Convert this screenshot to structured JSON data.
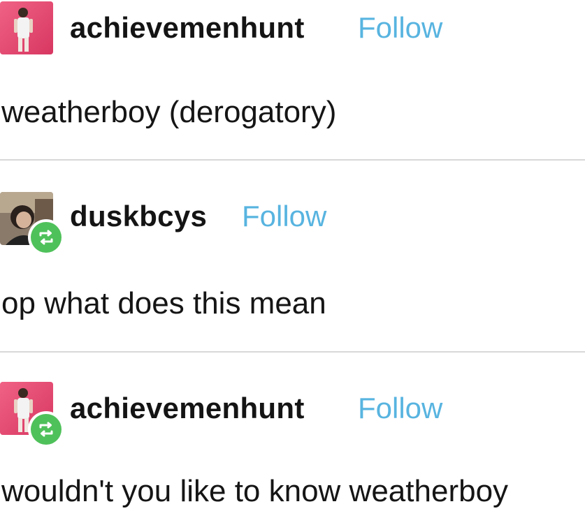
{
  "posts": [
    {
      "avatar_icon": "person-photo-avatar-pink",
      "username": "achievemenhunt",
      "follow_label": "Follow",
      "text": "weatherboy (derogatory)",
      "reblogged": false
    },
    {
      "avatar_icon": "person-photo-avatar-dark",
      "username": "duskbcys",
      "follow_label": "Follow",
      "text": "op what does this mean",
      "reblogged": true,
      "badge_icon": "reblog-icon"
    },
    {
      "avatar_icon": "person-photo-avatar-pink",
      "username": "achievemenhunt",
      "follow_label": "Follow",
      "text": "wouldn't you like to know weatherboy",
      "reblogged": true,
      "badge_icon": "reblog-icon"
    }
  ],
  "colors": {
    "follow": "#58b4e0",
    "reblog_badge": "#4fc15a",
    "divider": "#d8d8d8",
    "avatar_pink": "#e8446e"
  }
}
